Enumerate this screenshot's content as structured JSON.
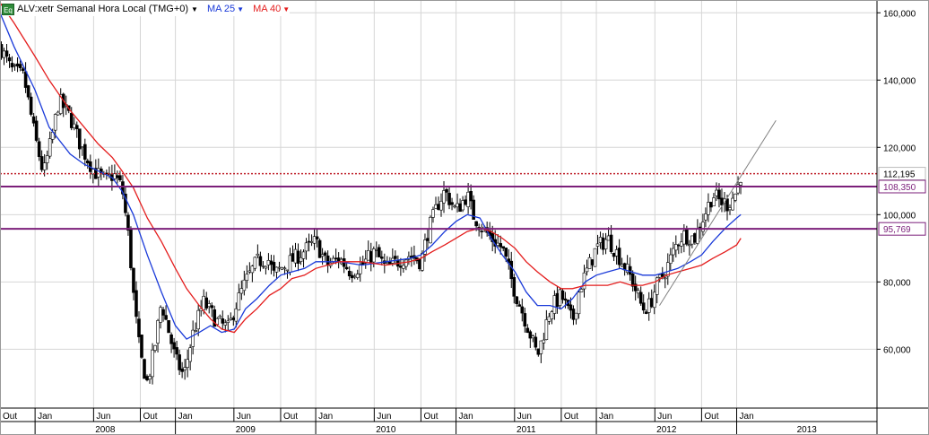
{
  "header": {
    "eq_icon": "Eq",
    "symbol": "ALV:xetr Semanal Hora Local (TMG+0)",
    "ma1": {
      "label": "MA 25",
      "color": "#1a3ad9"
    },
    "ma2": {
      "label": "MA 40",
      "color": "#e41d1d"
    }
  },
  "chart_data": {
    "type": "candlestick",
    "title": "ALV:xetr Semanal Hora Local (TMG+0)",
    "y_ticks": [
      "60,000",
      "80,000",
      "100,000",
      "120,000",
      "140,000",
      "160,000"
    ],
    "y_tick_values": [
      60,
      80,
      100,
      120,
      140,
      160
    ],
    "ylim": [
      42.5,
      163.8
    ],
    "x_range": [
      2007.75,
      2014.0
    ],
    "x_month_labels": [
      {
        "t": 2007.75,
        "label": "Out"
      },
      {
        "t": 2008.0,
        "label": "Jan"
      },
      {
        "t": 2008.417,
        "label": "Jun"
      },
      {
        "t": 2008.75,
        "label": "Out"
      },
      {
        "t": 2009.0,
        "label": "Jan"
      },
      {
        "t": 2009.417,
        "label": "Jun"
      },
      {
        "t": 2009.75,
        "label": "Out"
      },
      {
        "t": 2010.0,
        "label": "Jan"
      },
      {
        "t": 2010.417,
        "label": "Jun"
      },
      {
        "t": 2010.75,
        "label": "Out"
      },
      {
        "t": 2011.0,
        "label": "Jan"
      },
      {
        "t": 2011.417,
        "label": "Jun"
      },
      {
        "t": 2011.75,
        "label": "Out"
      },
      {
        "t": 2012.0,
        "label": "Jan"
      },
      {
        "t": 2012.417,
        "label": "Jun"
      },
      {
        "t": 2012.75,
        "label": "Out"
      },
      {
        "t": 2013.0,
        "label": "Jan"
      }
    ],
    "x_year_labels": [
      {
        "t": 2008,
        "label": "2008"
      },
      {
        "t": 2009,
        "label": "2009"
      },
      {
        "t": 2010,
        "label": "2010"
      },
      {
        "t": 2011,
        "label": "2011"
      },
      {
        "t": 2012,
        "label": "2012"
      },
      {
        "t": 2013,
        "label": "2013"
      }
    ],
    "price_path": [
      [
        2007.75,
        150
      ],
      [
        2007.83,
        143
      ],
      [
        2007.92,
        141
      ],
      [
        2008.0,
        123
      ],
      [
        2008.06,
        112
      ],
      [
        2008.12,
        123
      ],
      [
        2008.17,
        134
      ],
      [
        2008.25,
        129
      ],
      [
        2008.33,
        120
      ],
      [
        2008.42,
        113
      ],
      [
        2008.5,
        110
      ],
      [
        2008.56,
        112
      ],
      [
        2008.62,
        108
      ],
      [
        2008.67,
        92
      ],
      [
        2008.71,
        72
      ],
      [
        2008.75,
        58
      ],
      [
        2008.8,
        50
      ],
      [
        2008.85,
        60
      ],
      [
        2008.9,
        74
      ],
      [
        2008.96,
        64
      ],
      [
        2009.0,
        57
      ],
      [
        2009.06,
        52
      ],
      [
        2009.12,
        64
      ],
      [
        2009.2,
        74
      ],
      [
        2009.25,
        71
      ],
      [
        2009.3,
        68
      ],
      [
        2009.38,
        66
      ],
      [
        2009.42,
        72
      ],
      [
        2009.5,
        80
      ],
      [
        2009.58,
        86
      ],
      [
        2009.66,
        87
      ],
      [
        2009.7,
        82
      ],
      [
        2009.75,
        84
      ],
      [
        2009.85,
        87
      ],
      [
        2010.0,
        92
      ],
      [
        2010.08,
        85
      ],
      [
        2010.17,
        87
      ],
      [
        2010.25,
        83
      ],
      [
        2010.33,
        85
      ],
      [
        2010.42,
        89
      ],
      [
        2010.5,
        84
      ],
      [
        2010.58,
        86
      ],
      [
        2010.67,
        88
      ],
      [
        2010.75,
        86
      ],
      [
        2010.8,
        95
      ],
      [
        2010.88,
        104
      ],
      [
        2010.92,
        107
      ],
      [
        2011.0,
        101
      ],
      [
        2011.08,
        106
      ],
      [
        2011.12,
        100
      ],
      [
        2011.17,
        97
      ],
      [
        2011.25,
        93
      ],
      [
        2011.33,
        90
      ],
      [
        2011.42,
        77
      ],
      [
        2011.5,
        68
      ],
      [
        2011.58,
        58
      ],
      [
        2011.62,
        64
      ],
      [
        2011.67,
        72
      ],
      [
        2011.75,
        76
      ],
      [
        2011.83,
        68
      ],
      [
        2011.88,
        78
      ],
      [
        2011.94,
        84
      ],
      [
        2012.0,
        90
      ],
      [
        2012.08,
        93
      ],
      [
        2012.17,
        87
      ],
      [
        2012.25,
        81
      ],
      [
        2012.33,
        72
      ],
      [
        2012.38,
        73
      ],
      [
        2012.42,
        78
      ],
      [
        2012.5,
        84
      ],
      [
        2012.58,
        92
      ],
      [
        2012.62,
        94
      ],
      [
        2012.7,
        93
      ],
      [
        2012.75,
        98
      ],
      [
        2012.83,
        106
      ],
      [
        2012.88,
        104
      ],
      [
        2012.94,
        103
      ],
      [
        2013.0,
        107
      ],
      [
        2013.03,
        112
      ]
    ],
    "series": [
      {
        "name": "MA 25",
        "color": "#1a3ad9",
        "points": [
          [
            2007.75,
            160
          ],
          [
            2007.85,
            150
          ],
          [
            2008.0,
            137
          ],
          [
            2008.1,
            126
          ],
          [
            2008.25,
            118
          ],
          [
            2008.35,
            115
          ],
          [
            2008.45,
            113
          ],
          [
            2008.55,
            111
          ],
          [
            2008.62,
            107
          ],
          [
            2008.7,
            100
          ],
          [
            2008.8,
            88
          ],
          [
            2008.9,
            77
          ],
          [
            2009.0,
            67
          ],
          [
            2009.08,
            63
          ],
          [
            2009.17,
            65
          ],
          [
            2009.25,
            67
          ],
          [
            2009.33,
            65
          ],
          [
            2009.42,
            66
          ],
          [
            2009.5,
            72
          ],
          [
            2009.58,
            75
          ],
          [
            2009.67,
            79
          ],
          [
            2009.75,
            82
          ],
          [
            2009.83,
            83
          ],
          [
            2009.92,
            84
          ],
          [
            2010.0,
            86
          ],
          [
            2010.17,
            86
          ],
          [
            2010.33,
            85
          ],
          [
            2010.5,
            86
          ],
          [
            2010.67,
            87
          ],
          [
            2010.75,
            88
          ],
          [
            2010.83,
            91
          ],
          [
            2010.92,
            95
          ],
          [
            2011.0,
            98
          ],
          [
            2011.08,
            100
          ],
          [
            2011.17,
            99
          ],
          [
            2011.25,
            93
          ],
          [
            2011.33,
            88
          ],
          [
            2011.42,
            83
          ],
          [
            2011.5,
            77
          ],
          [
            2011.58,
            73
          ],
          [
            2011.67,
            73
          ],
          [
            2011.75,
            72
          ],
          [
            2011.83,
            75
          ],
          [
            2011.92,
            80
          ],
          [
            2012.0,
            82
          ],
          [
            2012.08,
            83
          ],
          [
            2012.17,
            84
          ],
          [
            2012.25,
            83
          ],
          [
            2012.33,
            82
          ],
          [
            2012.42,
            82
          ],
          [
            2012.5,
            83
          ],
          [
            2012.58,
            84
          ],
          [
            2012.67,
            86
          ],
          [
            2012.75,
            88
          ],
          [
            2012.83,
            92
          ],
          [
            2012.92,
            96
          ],
          [
            2013.0,
            99
          ],
          [
            2013.03,
            100
          ]
        ]
      },
      {
        "name": "MA 40",
        "color": "#e41d1d",
        "points": [
          [
            2007.75,
            163
          ],
          [
            2007.85,
            157
          ],
          [
            2008.0,
            147
          ],
          [
            2008.1,
            140
          ],
          [
            2008.25,
            131
          ],
          [
            2008.35,
            126
          ],
          [
            2008.45,
            121
          ],
          [
            2008.55,
            117
          ],
          [
            2008.62,
            113
          ],
          [
            2008.7,
            108
          ],
          [
            2008.8,
            99
          ],
          [
            2008.9,
            92
          ],
          [
            2009.0,
            84
          ],
          [
            2009.08,
            78
          ],
          [
            2009.17,
            73
          ],
          [
            2009.25,
            69
          ],
          [
            2009.33,
            66
          ],
          [
            2009.42,
            65
          ],
          [
            2009.5,
            69
          ],
          [
            2009.58,
            72
          ],
          [
            2009.67,
            76
          ],
          [
            2009.75,
            78
          ],
          [
            2009.83,
            81
          ],
          [
            2009.92,
            82
          ],
          [
            2010.0,
            84
          ],
          [
            2010.17,
            86
          ],
          [
            2010.33,
            86
          ],
          [
            2010.5,
            85
          ],
          [
            2010.67,
            86
          ],
          [
            2010.75,
            87
          ],
          [
            2010.83,
            89
          ],
          [
            2010.92,
            91
          ],
          [
            2011.0,
            93
          ],
          [
            2011.08,
            95
          ],
          [
            2011.17,
            96
          ],
          [
            2011.25,
            95
          ],
          [
            2011.33,
            93
          ],
          [
            2011.42,
            90
          ],
          [
            2011.5,
            86
          ],
          [
            2011.58,
            83
          ],
          [
            2011.67,
            80
          ],
          [
            2011.75,
            78
          ],
          [
            2011.83,
            78
          ],
          [
            2011.92,
            79
          ],
          [
            2012.0,
            79
          ],
          [
            2012.08,
            79
          ],
          [
            2012.17,
            80
          ],
          [
            2012.25,
            79
          ],
          [
            2012.33,
            79
          ],
          [
            2012.42,
            80
          ],
          [
            2012.5,
            82
          ],
          [
            2012.58,
            83
          ],
          [
            2012.67,
            84
          ],
          [
            2012.75,
            85
          ],
          [
            2012.83,
            87
          ],
          [
            2012.92,
            89
          ],
          [
            2013.0,
            91
          ],
          [
            2013.03,
            93
          ]
        ]
      }
    ],
    "horizontal_lines": [
      {
        "value": 112.195,
        "label": "112,195",
        "color": "#c0202a",
        "style": "dotted"
      },
      {
        "value": 108.35,
        "label": "108,350",
        "color": "#7b1f7a",
        "style": "solid"
      },
      {
        "value": 95.769,
        "label": "95,769",
        "color": "#7b1f7a",
        "style": "solid"
      }
    ],
    "trendline": {
      "from": [
        2012.45,
        73
      ],
      "to": [
        2013.28,
        128
      ],
      "color": "#808080"
    },
    "grid": true,
    "y_axis_position": "right"
  }
}
